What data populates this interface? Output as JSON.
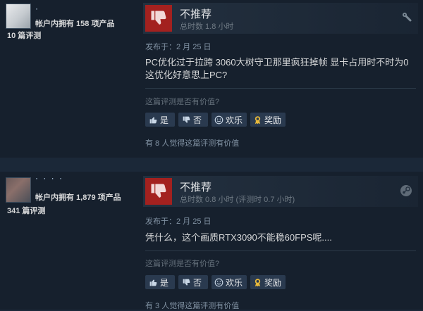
{
  "reviews": [
    {
      "username": "·",
      "products": "帐户内拥有 158 项产品",
      "review_count": "10 篇评测",
      "recommendation": "不推荐",
      "hours": "总时数 1.8 小时",
      "posted": "发布于：2 月 25 日",
      "body_line1": "PC优化过于拉跨 3060大树守卫那里疯狂掉帧 显卡占用时不时为0",
      "body_line2": "这优化好意思上PC?",
      "helpful_question": "这篇评测是否有价值?",
      "btn_yes": "是",
      "btn_no": "否",
      "btn_funny": "欢乐",
      "btn_award": "奖励",
      "found_helpful": "有 8 人觉得这篇评测有价值",
      "corner_icon": "settings-icon"
    },
    {
      "username": "· · · ·",
      "products": "帐户内拥有 1,879 项产品",
      "review_count": "341 篇评测",
      "recommendation": "不推荐",
      "hours": "总时数 0.8 小时   (评测时 0.7 小时)",
      "posted": "发布于：2 月 25 日",
      "body_line1": "凭什么，这个画质RTX3090不能稳60FPS呢....",
      "body_line2": "",
      "helpful_question": "这篇评测是否有价值?",
      "btn_yes": "是",
      "btn_no": "否",
      "btn_funny": "欢乐",
      "btn_award": "奖励",
      "found_helpful": "有 3 人觉得这篇评测有价值",
      "corner_icon": "steam-logo-icon"
    }
  ],
  "colors": {
    "page_bg": "#1b2838",
    "panel_bg": "#16202d",
    "thumb_red": "#a3211f",
    "link_blue": "#c1dbf4",
    "button_bg": "#2a3a4f"
  }
}
